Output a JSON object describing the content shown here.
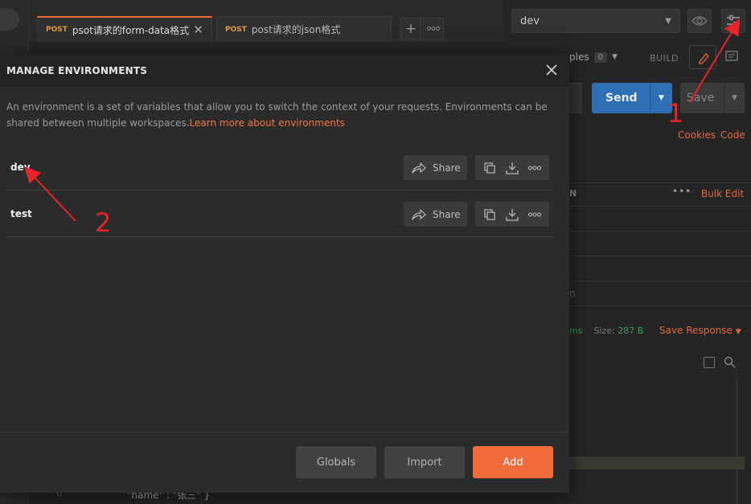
{
  "background": {
    "tabs": [
      {
        "method": "POST",
        "title": "psot请求的form-data格式",
        "close_glyph": "✕"
      },
      {
        "method": "POST",
        "title": "post请求的json格式"
      }
    ],
    "tab_add_glyph": "+",
    "tab_more_glyph": "ooo",
    "environment_select": {
      "value": "dev",
      "caret_icon": "caret-down-icon"
    },
    "examples_label": "ples",
    "examples_count": "0",
    "build_label": "BUILD",
    "send_label": "Send",
    "save_label": "Save",
    "cookies_label": "Cookies",
    "code_label": "Code",
    "table_header_fragment": "N",
    "more_glyph": "•••",
    "bulk_edit_label": "Bulk Edit",
    "row_fragment": "n",
    "status_fragment": "ms",
    "size_label": "Size:",
    "size_value": "287 B",
    "save_response_label": "Save Response",
    "code_line": "\"name\" : \"张三\" }",
    "line_number": "6"
  },
  "modal": {
    "title": "MANAGE ENVIRONMENTS",
    "description": "An environment is a set of variables that allow you to switch the context of your requests. Environments can be shared between multiple workspaces.",
    "learn_more_link": "Learn more about environments",
    "environments": [
      {
        "name": "dev",
        "share_label": "Share"
      },
      {
        "name": "test",
        "share_label": "Share"
      }
    ],
    "footer": {
      "globals_label": "Globals",
      "import_label": "Import",
      "add_label": "Add"
    }
  },
  "annotations": {
    "marker_1": "1",
    "marker_2": "2",
    "color": "#e8242a"
  },
  "colors": {
    "accent": "#f26b3a",
    "send": "#2f6fb5",
    "link": "#f07840",
    "success": "#3d9c5e"
  }
}
